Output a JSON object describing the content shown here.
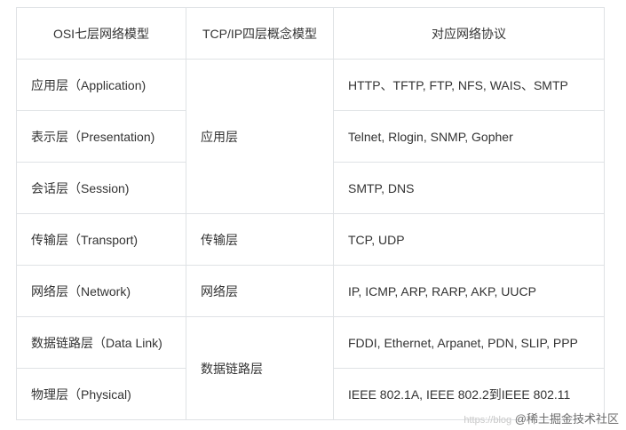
{
  "table": {
    "headers": [
      "OSI七层网络模型",
      "TCP/IP四层概念模型",
      "对应网络协议"
    ],
    "osi": [
      "应用层（Application)",
      "表示层（Presentation)",
      "会话层（Session)",
      "传输层（Transport)",
      "网络层（Network)",
      "数据链路层（Data Link)",
      "物理层（Physical)"
    ],
    "tcpip": [
      "应用层",
      "传输层",
      "网络层",
      "数据链路层"
    ],
    "protocols": [
      "HTTP、TFTP, FTP, NFS, WAIS、SMTP",
      "Telnet, Rlogin, SNMP, Gopher",
      "SMTP, DNS",
      "TCP, UDP",
      "IP, ICMP, ARP, RARP, AKP, UUCP",
      "FDDI, Ethernet, Arpanet, PDN, SLIP, PPP",
      "IEEE 802.1A, IEEE 802.2到IEEE 802.11"
    ]
  },
  "watermark": {
    "url": "https://blog",
    "brand": "@稀土掘金技术社区"
  }
}
